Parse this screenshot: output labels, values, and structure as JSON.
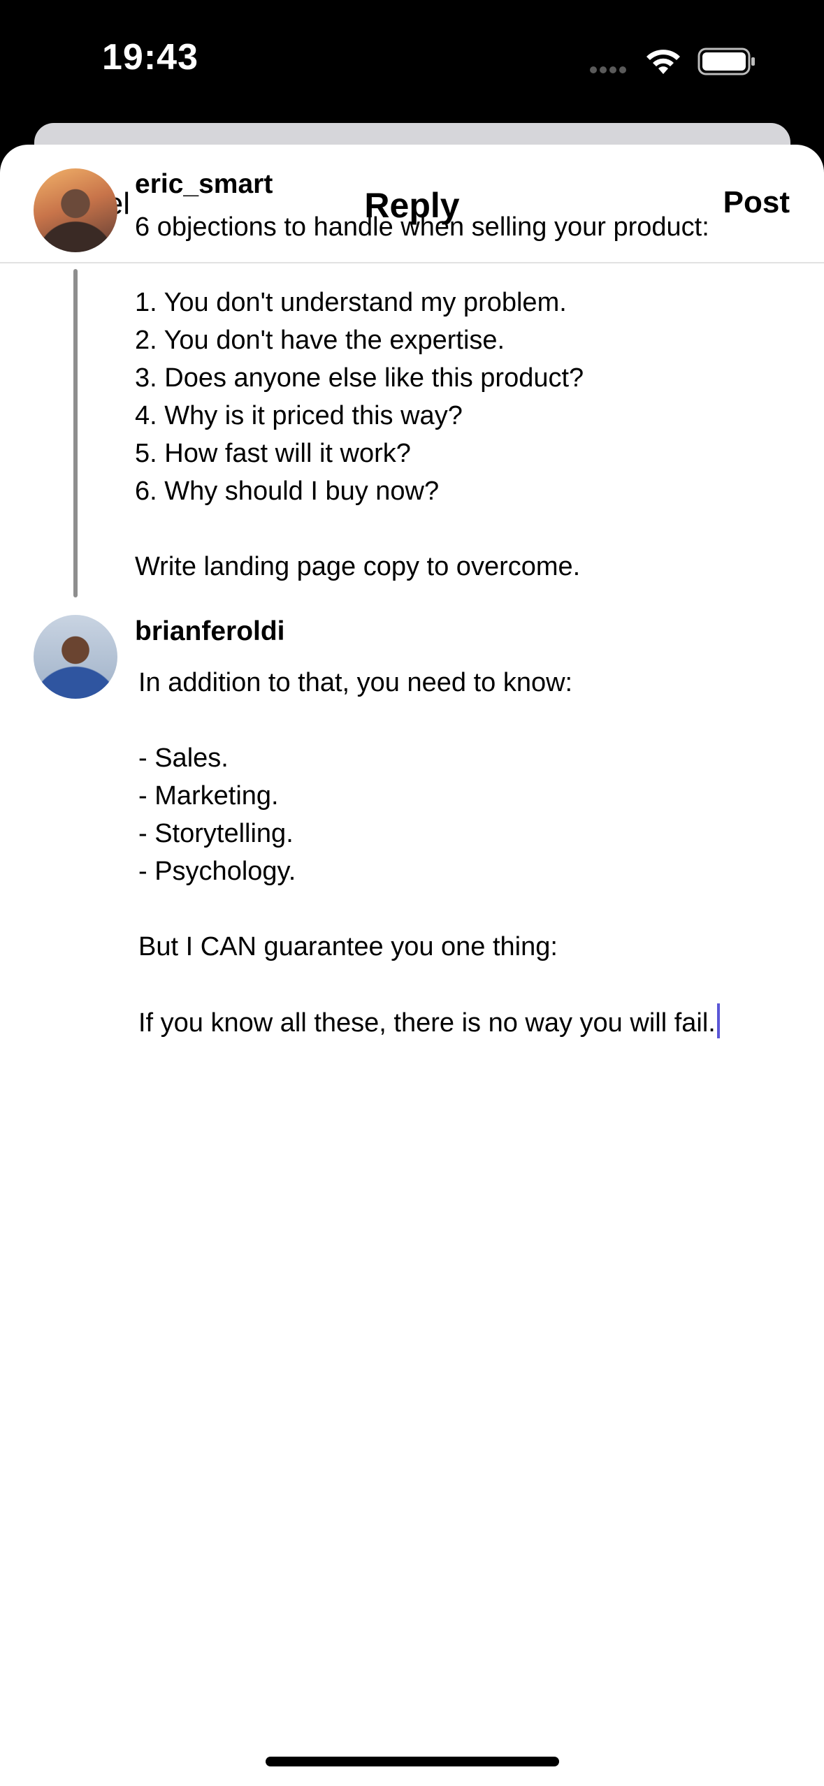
{
  "status_bar": {
    "time": "19:43"
  },
  "nav": {
    "cancel_label": "Cancel",
    "title": "Reply",
    "post_label": "Post"
  },
  "original_post": {
    "username": "eric_smart",
    "intro": "6 objections to handle when selling your product:",
    "items": [
      "1. You don't understand my problem.",
      "2. You don't have the expertise.",
      "3. Does anyone else like this product?",
      "4. Why is it priced this way?",
      "5. How fast will it work?",
      "6. Why should I buy now?"
    ],
    "closing": "Write landing page copy to overcome."
  },
  "reply": {
    "username": "brianferoldi",
    "intro": "In addition to that, you need to know:",
    "items": [
      "- Sales.",
      "- Marketing.",
      "- Storytelling.",
      "- Psychology."
    ],
    "line2": "But I CAN guarantee you one thing:",
    "line3": "If you know all these, there is no way you will fail."
  },
  "icons": {
    "signal": "cellular-signal-icon",
    "wifi": "wifi-icon",
    "battery": "battery-icon"
  },
  "colors": {
    "cursor": "#5b57d6",
    "thread_line": "#8e8e8e"
  }
}
